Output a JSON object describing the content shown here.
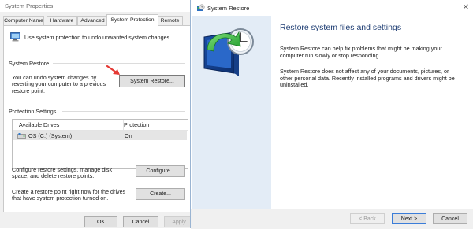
{
  "system_properties": {
    "title": "System Properties",
    "tabs": [
      "Computer Name",
      "Hardware",
      "Advanced",
      "System Protection",
      "Remote"
    ],
    "active_tab": "System Protection",
    "intro": "Use system protection to undo unwanted system changes.",
    "system_restore": {
      "label": "System Restore",
      "description": "You can undo system changes by reverting your computer to a previous restore point.",
      "button": "System Restore..."
    },
    "protection_settings": {
      "label": "Protection Settings",
      "columns": [
        "Available Drives",
        "Protection"
      ],
      "rows": [
        {
          "drive": "OS (C:) (System)",
          "protection": "On"
        }
      ]
    },
    "configure": {
      "description": "Configure restore settings, manage disk space, and delete restore points.",
      "button": "Configure..."
    },
    "create": {
      "description": "Create a restore point right now for the drives that have system protection turned on.",
      "button": "Create..."
    },
    "buttons": {
      "ok": "OK",
      "cancel": "Cancel",
      "apply": "Apply"
    }
  },
  "wizard": {
    "title": "System Restore",
    "close_glyph": "✕",
    "heading": "Restore system files and settings",
    "paragraph1": "System Restore can help fix problems that might be making your computer run slowly or stop responding.",
    "paragraph2": "System Restore does not affect any of your documents, pictures, or other personal data. Recently installed programs and drivers might be uninstalled.",
    "buttons": {
      "back": "< Back",
      "next": "Next >",
      "cancel": "Cancel"
    }
  },
  "colors": {
    "heading": "#1e3d73",
    "sidebar": "#e3ecf6",
    "selected_row": "#e5e5e5",
    "arrow": "#e53935",
    "accent_border": "#3b7dd8"
  }
}
